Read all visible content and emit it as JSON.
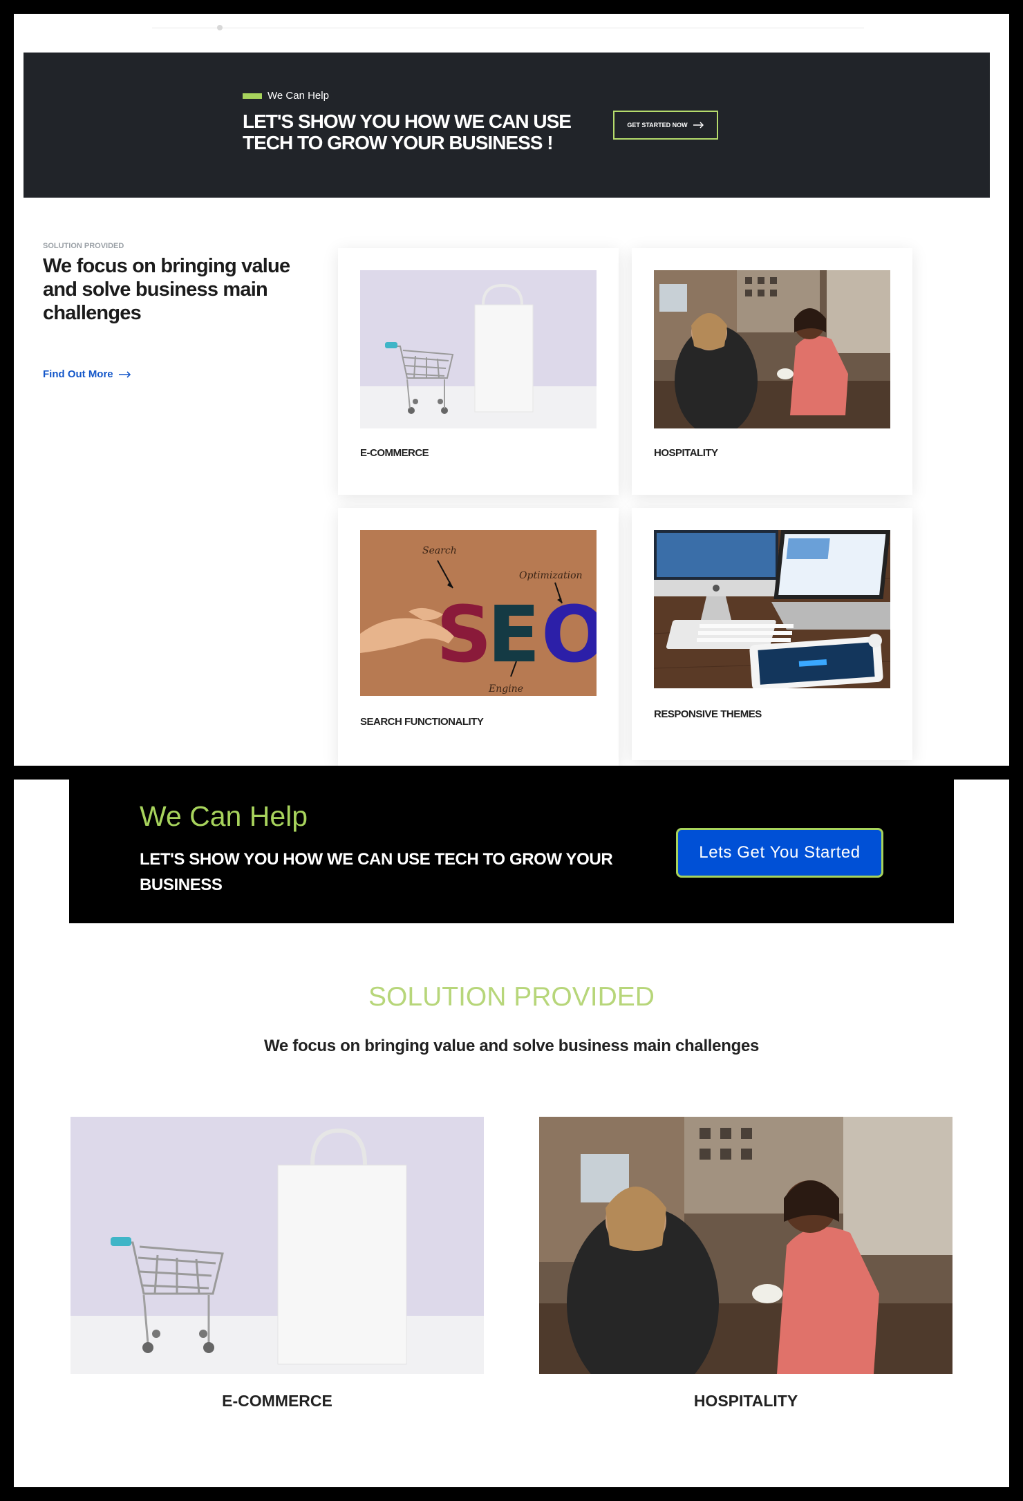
{
  "top": {
    "cta": {
      "eyebrow": "We Can Help",
      "heading": "LET'S SHOW YOU HOW WE CAN USE TECH TO GROW YOUR BUSINESS !",
      "button_label": "GET STARTED NOW"
    },
    "solutions": {
      "eyebrow": "SOLUTION PROVIDED",
      "title": "We focus on bringing value and solve business main challenges",
      "link_label": "Find Out More",
      "cards": [
        {
          "label": "E-COMMERCE"
        },
        {
          "label": "HOSPITALITY"
        },
        {
          "label": "SEARCH FUNCTIONALITY"
        },
        {
          "label": "RESPONSIVE THEMES"
        }
      ]
    },
    "seo_image": {
      "word": "SEO",
      "tags": [
        "Search",
        "Optimization",
        "Engine"
      ]
    }
  },
  "bottom": {
    "cta": {
      "eyebrow": "We Can Help",
      "heading": "LET'S SHOW YOU HOW WE CAN USE TECH TO GROW YOUR BUSINESS",
      "button_label": "Lets Get You Started"
    },
    "solutions": {
      "eyebrow": "SOLUTION PROVIDED",
      "subtitle": "We focus on bringing value and solve business main challenges",
      "cards": [
        {
          "label": "E-COMMERCE"
        },
        {
          "label": "HOSPITALITY"
        }
      ]
    }
  },
  "colors": {
    "accent_green": "#a7d35c",
    "link_blue": "#1457c9",
    "button_blue": "#0050d6",
    "dark_bg": "#212429"
  }
}
